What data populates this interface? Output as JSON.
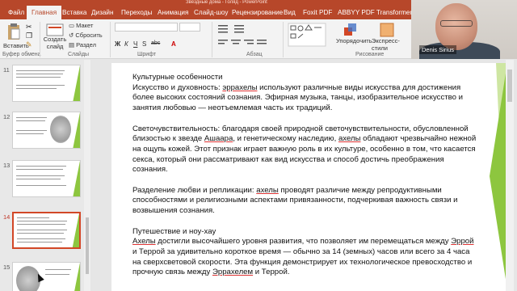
{
  "window": {
    "title": "Звёздные дома - Голяд - PowerPoint"
  },
  "tabs": [
    "Файл",
    "Главная",
    "Вставка",
    "Дизайн",
    "Переходы",
    "Анимация",
    "Слайд-шоу",
    "Рецензирование",
    "Вид",
    "Foxit PDF",
    "ABBYY PDF Transformer+"
  ],
  "ribbon": {
    "paste": "Вставить",
    "create_slide": "Создать слайд",
    "layout": "Макет",
    "reset": "Сбросить",
    "section": "Раздел",
    "arrange": "Упорядочить",
    "quick_styles": "Экспресс-стили",
    "groups": {
      "clipboard": "Буфер обмена",
      "slides": "Слайды",
      "font": "Шрифт",
      "paragraph": "Абзац",
      "drawing": "Рисование"
    },
    "format_buttons": [
      "Ж",
      "К",
      "Ч",
      "S",
      "abc"
    ]
  },
  "video": {
    "name": "Denis Sirius"
  },
  "thumbnails": [
    {
      "num": "11",
      "selected": false
    },
    {
      "num": "12",
      "selected": false
    },
    {
      "num": "13",
      "selected": false
    },
    {
      "num": "14",
      "selected": true
    },
    {
      "num": "15",
      "selected": false
    }
  ],
  "slide": {
    "heading": "Культурные особенности",
    "p1_head": "Искусство и духовность: ",
    "p1_u": "эррахелы",
    "p1_rest": " используют различные виды искусства для достижения более высоких состояний сознания. Эфирная музыка, танцы, изобразительное искусство и занятия любовью — неотъемлемая часть их традиций.",
    "p2_a": "Светочувствительность: благодаря своей природной светочувствительности, обусловленной близостью к звезде ",
    "p2_u1": "Ашаара",
    "p2_b": ", и генетическому наследию, ",
    "p2_u2": "ахелы",
    "p2_c": " обладают чрезвычайно нежной на ощупь кожей. Этот признак играет важную роль в их культуре, особенно в том, что касается секса, который они рассматривают как вид искусства и способ достичь преображения сознания.",
    "p3_a": "Разделение любви и репликации: ",
    "p3_u": "ахелы",
    "p3_b": " проводят различие между репродуктивными способностями и религиозными аспектами привязанности, подчеркивая важность связи и возвышения сознания.",
    "p4_head": "Путешествие и ноу-хау",
    "p4_u1": "Ахелы",
    "p4_a": " достигли высочайшего уровня развития, что позволяет им перемещаться между ",
    "p4_u2": "Эррой",
    "p4_b": " и Террой за удивительно короткое время — обычно за 14 (земных) часов или всего за 4 часа на сверхсветовой скорости. Эта функция демонстрирует их технологическое превосходство и прочную связь между ",
    "p4_u3": "Эррахелем",
    "p4_c": " и Террой."
  }
}
